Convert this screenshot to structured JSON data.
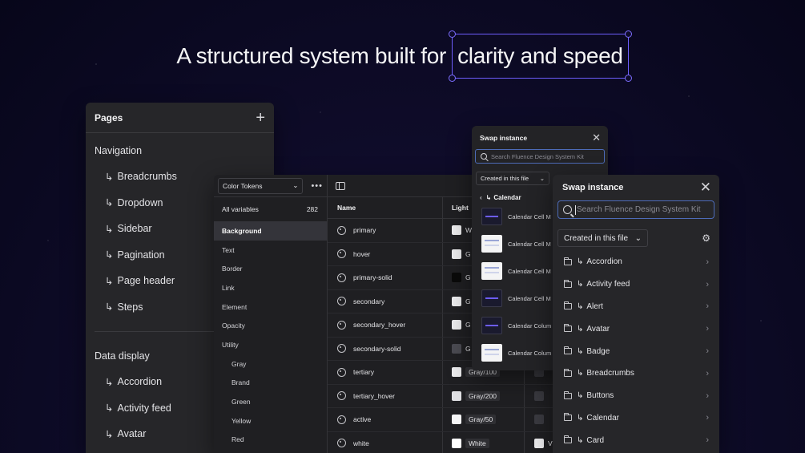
{
  "headline": {
    "plain": "A structured system built for",
    "highlighted": "clarity and speed",
    "accent_color": "#6d5dfc"
  },
  "pages_panel": {
    "title": "Pages",
    "add_icon": "plus-icon",
    "sections": [
      {
        "title": "Navigation",
        "items": [
          "Breadcrumbs",
          "Dropdown",
          "Sidebar",
          "Pagination",
          "Page header",
          "Steps"
        ]
      },
      {
        "title": "Data display",
        "items": [
          "Accordion",
          "Activity feed",
          "Avatar"
        ]
      }
    ]
  },
  "tokens_panel": {
    "collection_select": "Color Tokens",
    "all_variables_label": "All variables",
    "all_variables_count": "282",
    "groups": [
      {
        "label": "Background",
        "active": true,
        "sub": false
      },
      {
        "label": "Text",
        "active": false,
        "sub": false
      },
      {
        "label": "Border",
        "active": false,
        "sub": false
      },
      {
        "label": "Link",
        "active": false,
        "sub": false
      },
      {
        "label": "Element",
        "active": false,
        "sub": false
      },
      {
        "label": "Opacity",
        "active": false,
        "sub": false
      },
      {
        "label": "Utility",
        "active": false,
        "sub": false
      },
      {
        "label": "Gray",
        "active": false,
        "sub": true
      },
      {
        "label": "Brand",
        "active": false,
        "sub": true
      },
      {
        "label": "Green",
        "active": false,
        "sub": true
      },
      {
        "label": "Yellow",
        "active": false,
        "sub": true
      },
      {
        "label": "Red",
        "active": false,
        "sub": true
      }
    ],
    "columns": [
      "Name",
      "Light"
    ],
    "rows": [
      {
        "name": "primary",
        "light_swatch": "#ececee",
        "light_value": "W",
        "dark_swatch": "",
        "dark_value": ""
      },
      {
        "name": "hover",
        "light_swatch": "#ececee",
        "light_value": "G",
        "dark_swatch": "",
        "dark_value": ""
      },
      {
        "name": "primary-solid",
        "light_swatch": "#0a0a0a",
        "light_value": "G",
        "dark_swatch": "",
        "dark_value": ""
      },
      {
        "name": "secondary",
        "light_swatch": "#ececee",
        "light_value": "G",
        "dark_swatch": "",
        "dark_value": ""
      },
      {
        "name": "secondary_hover",
        "light_swatch": "#ececee",
        "light_value": "G",
        "dark_swatch": "",
        "dark_value": ""
      },
      {
        "name": "secondary-solid",
        "light_swatch": "#4b4b52",
        "light_value": "G",
        "dark_swatch": "",
        "dark_value": ""
      },
      {
        "name": "tertiary",
        "light_swatch": "#ececee",
        "light_value": "Gray/100",
        "dark_swatch": "#3a3a40",
        "dark_value": ""
      },
      {
        "name": "tertiary_hover",
        "light_swatch": "#e0e0e3",
        "light_value": "Gray/200",
        "dark_swatch": "#3a3a40",
        "dark_value": ""
      },
      {
        "name": "active",
        "light_swatch": "#f6f6f7",
        "light_value": "Gray/50",
        "dark_swatch": "#3a3a40",
        "dark_value": ""
      },
      {
        "name": "white",
        "light_swatch": "#ffffff",
        "light_value": "White",
        "dark_swatch": "#ececee",
        "dark_value": "V"
      }
    ]
  },
  "swap_small": {
    "title": "Swap instance",
    "search_placeholder": "Search Fluence Design System Kit",
    "filter": "Created in this file",
    "back_label": "Calendar",
    "items": [
      {
        "label": "Calendar Cell M",
        "thumb": "dark"
      },
      {
        "label": "Calendar Cell M",
        "thumb": "light"
      },
      {
        "label": "Calendar Cell M",
        "thumb": "light"
      },
      {
        "label": "Calendar Cell M",
        "thumb": "dark"
      },
      {
        "label": "Calendar Colum",
        "thumb": "dark"
      },
      {
        "label": "Calendar Colum",
        "thumb": "light"
      }
    ]
  },
  "swap_large": {
    "title": "Swap instance",
    "search_placeholder": "Search Fluence Design System Kit",
    "filter": "Created in this file",
    "items": [
      "Accordion",
      "Activity feed",
      "Alert",
      "Avatar",
      "Badge",
      "Breadcrumbs",
      "Buttons",
      "Calendar",
      "Card"
    ]
  }
}
